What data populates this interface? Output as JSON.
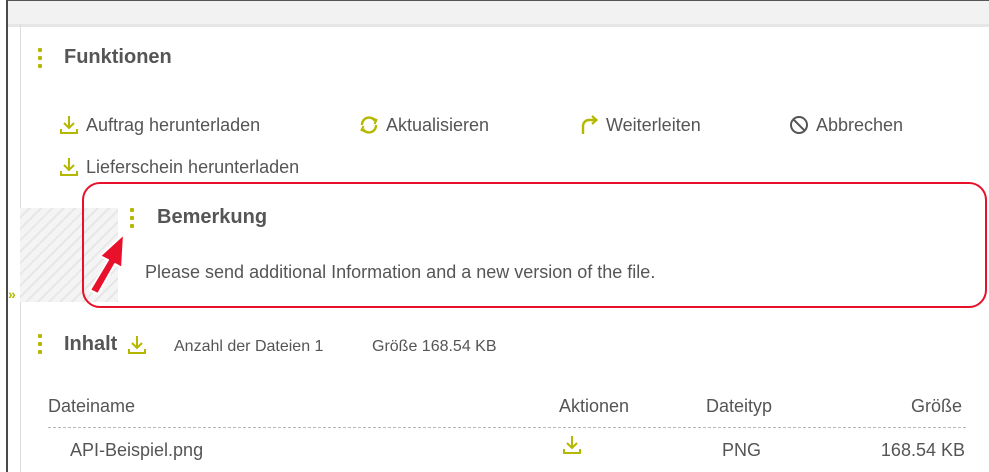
{
  "functions": {
    "title": "Funktionen",
    "actions": [
      {
        "label": "Auftrag herunterladen",
        "icon": "download-icon"
      },
      {
        "label": "Aktualisieren",
        "icon": "refresh-icon"
      },
      {
        "label": "Weiterleiten",
        "icon": "forward-icon"
      },
      {
        "label": "Abbrechen",
        "icon": "cancel-icon"
      },
      {
        "label": "Lieferschein herunterladen",
        "icon": "download-icon"
      }
    ]
  },
  "remark": {
    "title": "Bemerkung",
    "text": "Please send additional Information and a new version of the file."
  },
  "content": {
    "title": "Inhalt",
    "file_count": "Anzahl der Dateien 1",
    "size": "Größe 168.54 KB",
    "columns": [
      "Dateiname",
      "Aktionen",
      "Dateityp",
      "Größe"
    ],
    "rows": [
      {
        "name": "API-Beispiel.png",
        "type": "PNG",
        "size": "168.54 KB"
      }
    ]
  },
  "colors": {
    "accent": "#b5b800",
    "highlight": "#e8102a"
  }
}
